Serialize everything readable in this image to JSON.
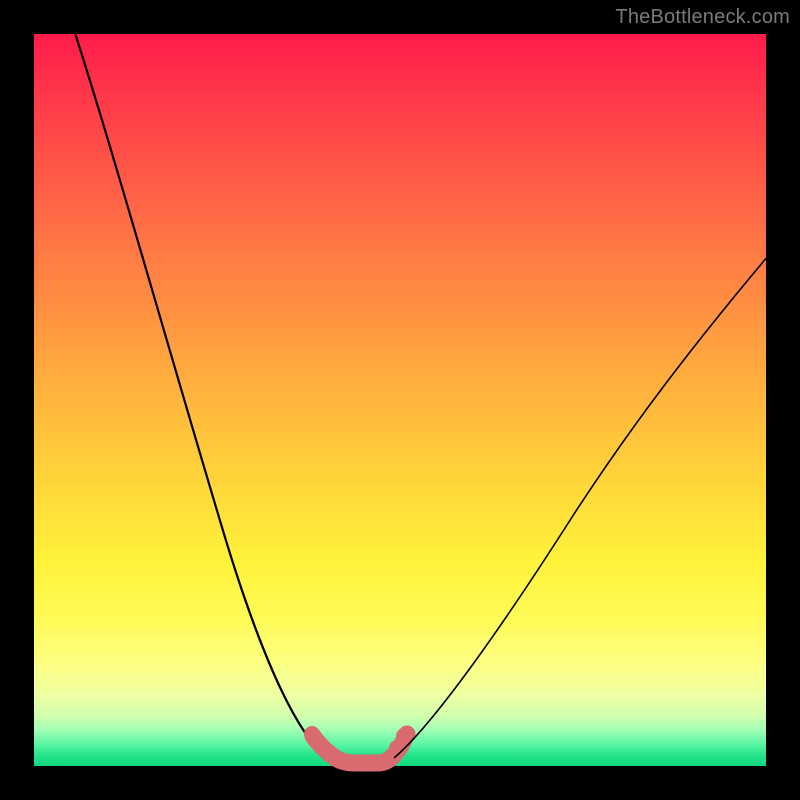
{
  "watermark": "TheBottleneck.com",
  "colors": {
    "flat_stroke": "#d96a6f",
    "curve_stroke": "#000000"
  },
  "chart_data": {
    "type": "line",
    "title": "",
    "xlabel": "",
    "ylabel": "",
    "xlim": [
      0,
      100
    ],
    "ylim": [
      0,
      100
    ],
    "grid": false,
    "legend": false,
    "series": [
      {
        "name": "bottleneck-curve",
        "x": [
          5,
          10,
          15,
          20,
          25,
          28,
          31,
          34,
          36,
          38,
          40,
          42,
          44,
          46,
          50,
          55,
          60,
          65,
          70,
          75,
          80,
          85,
          90,
          95,
          100
        ],
        "values": [
          100,
          87,
          73,
          59,
          44,
          34,
          24,
          14,
          8,
          4,
          1,
          0,
          0,
          0,
          2,
          8,
          15,
          22,
          29,
          36,
          44,
          52,
          58,
          64,
          70
        ]
      }
    ],
    "annotations": [
      {
        "name": "optimal-flat-region",
        "x_start": 38,
        "x_end": 48,
        "y": 0
      }
    ]
  }
}
